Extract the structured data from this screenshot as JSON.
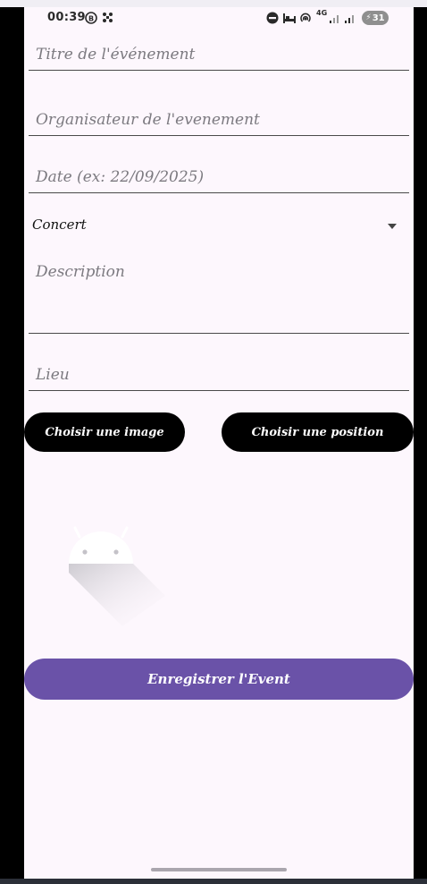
{
  "status_bar": {
    "time": "00:39",
    "battery": "31",
    "network": "4G"
  },
  "form": {
    "title_placeholder": "Titre de l'événement",
    "organizer_placeholder": "Organisateur de l'evenement",
    "date_placeholder": "Date (ex: 22/09/2025)",
    "category_selected": "Concert",
    "description_placeholder": "Description",
    "location_placeholder": "Lieu"
  },
  "buttons": {
    "choose_image": "Choisir une image",
    "choose_position": "Choisir une position",
    "save": "Enregistrer l'Event"
  },
  "colors": {
    "background": "#fdf7fd",
    "save_button": "#6a52a8",
    "pill_button": "#000000",
    "underline": "#4a4a4a"
  },
  "icons": {
    "image_preview": "android-robot-icon"
  }
}
